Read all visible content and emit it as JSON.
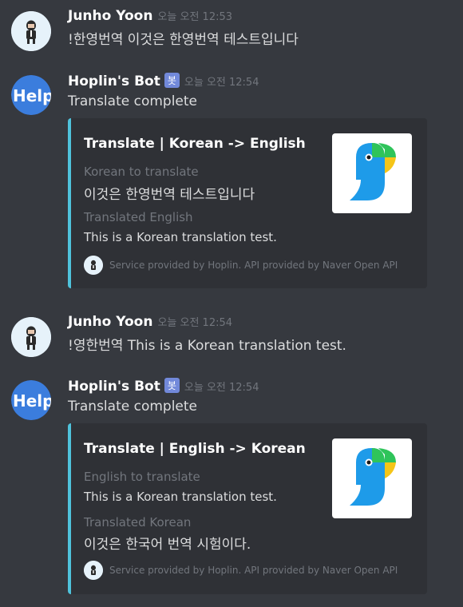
{
  "messages": [
    {
      "author": "Junho Yoon",
      "timestamp": "오늘 오전 12:53",
      "text": "!한영번역 이것은 한영번역 테스트입니다"
    },
    {
      "author": "Hoplin's Bot",
      "bot_badge": "봇",
      "timestamp": "오늘 오전 12:54",
      "text": "Translate complete",
      "embed": {
        "title": "Translate | Korean -> English",
        "field1_name": "Korean to translate",
        "field1_value": "이것은 한영번역 테스트입니다",
        "field2_name": "Translated English",
        "field2_value": "This is a Korean translation test.",
        "footer": "Service provided by Hoplin. API provided by Naver Open API"
      }
    },
    {
      "author": "Junho Yoon",
      "timestamp": "오늘 오전 12:54",
      "text": "!영한번역 This is a Korean translation test."
    },
    {
      "author": "Hoplin's Bot",
      "bot_badge": "봇",
      "timestamp": "오늘 오전 12:54",
      "text": "Translate complete",
      "embed": {
        "title": "Translate | English -> Korean",
        "field1_name": "English to translate",
        "field1_value": "This is a Korean translation test.",
        "field2_name": "Translated Korean",
        "field2_value": "이것은 한국어 번역 시험이다.",
        "footer": "Service provided by Hoplin. API provided by Naver Open API"
      }
    }
  ],
  "colors": {
    "background": "#36393f",
    "embed_background": "#2f3136",
    "embed_accent": "#4fc3dc",
    "bot_badge": "#7289da",
    "timestamp": "#72767d"
  },
  "icons": {
    "user_avatar": "person-avatar-icon",
    "bot_avatar": "help-avatar-icon",
    "embed_thumbnail": "papago-parrot-icon",
    "footer_icon": "person-avatar-icon"
  }
}
